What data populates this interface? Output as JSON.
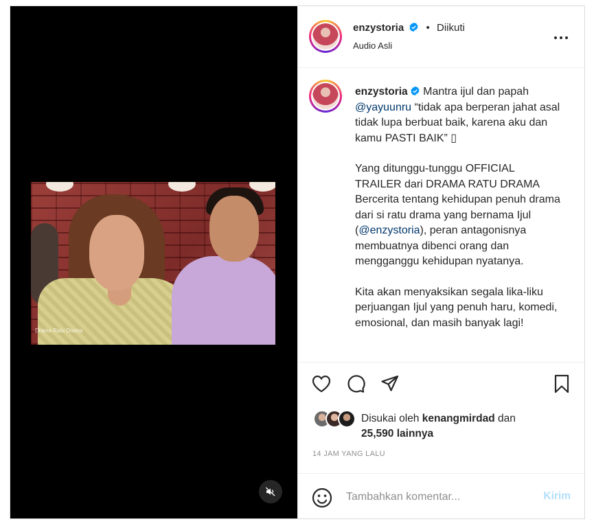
{
  "post": {
    "author": {
      "username": "enzystoria",
      "verified": true
    },
    "follow_state": "Diikuti",
    "audio_label": "Audio Asli",
    "video": {
      "muted": true,
      "watermark": "Drama Ratu Drama"
    },
    "caption": {
      "lead": "Mantra ijul dan papah",
      "mention1": "@yayuunru",
      "line1_rest": " “tidak apa berperan jahat asal tidak lupa berbuat baik, karena aku dan kamu PASTI BAIK” ",
      "emoji_box": "▯",
      "para2_a": "Yang ditunggu-tunggu OFFICIAL TRAILER dari DRAMA RATU DRAMA Bercerita tentang kehidupan penuh drama dari si ratu drama yang bernama Ijul (",
      "mention2": "@enzystoria",
      "para2_b": "), peran antagonisnya membuatnya dibenci orang dan mengganggu kehidupan nyatanya.",
      "para3": "Kita akan menyaksikan segala lika-liku perjuangan Ijul yang penuh haru, komedi, emosional, dan masih banyak lagi!"
    },
    "likes": {
      "prefix": "Disukai oleh",
      "liked_by": "kenangmirdad",
      "conjunction": "dan",
      "others": "25,590 lainnya"
    },
    "timestamp": "14 JAM YANG LALU",
    "comment": {
      "placeholder": "Tambahkan komentar...",
      "send_label": "Kirim"
    }
  },
  "colors": {
    "link": "#00376b",
    "verified": "#0095f6",
    "send_disabled": "#b2dffc",
    "muted_text": "#8e8e8e"
  },
  "icons": [
    "more-icon",
    "heart-icon",
    "comment-icon",
    "share-icon",
    "bookmark-icon",
    "emoji-icon",
    "mute-icon",
    "verified-icon"
  ]
}
